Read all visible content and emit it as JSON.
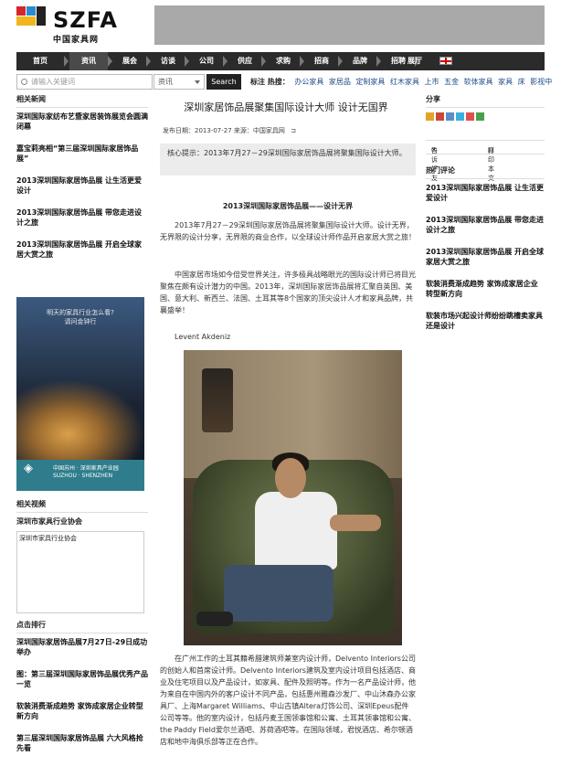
{
  "site": {
    "logo_text": "SZFA",
    "logo_sub": "中国家具网"
  },
  "nav": {
    "items": [
      "首页",
      "资讯",
      "展会",
      "访谈",
      "公司",
      "供应",
      "求购",
      "招商",
      "品牌",
      "招聘",
      "展厅"
    ],
    "active_index": 1
  },
  "search": {
    "placeholder": "请输入关键词",
    "category": "资讯",
    "button": "Search"
  },
  "hot": {
    "label": "标注 热搜：",
    "items": [
      "办公家具",
      "家居品",
      "定制家具",
      "红木家具",
      "上市",
      "五金",
      "软体家具",
      "家具",
      "床",
      "影视中"
    ]
  },
  "left": {
    "related_news_title": "相关新闻",
    "related_news": [
      "深圳国际家纺布艺暨家居装饰展览会圆满闭幕",
      "嘉宝莉亮相“第三届深圳国际家居饰品展”",
      "2013深圳国际家居饰品展 让生活更爱设计",
      "2013深圳国际家居饰品展 带您走进设计之旅",
      "2013深圳国际家居饰品展 开启全球家居大赏之旅"
    ],
    "ad_line1": "明天的家具行业怎么看?",
    "ad_line2": "请问金钟行",
    "ad_brand": "SUZHOU · SHENZHEN",
    "ad_brand_sub": "中国苏州 · 深圳家具产业园",
    "related_video_title": "相关视频",
    "video_link": "深圳市家具行业协会",
    "video_caption": "深圳市家具行业协会",
    "ranking_title": "点击排行",
    "ranking": [
      "深圳国际家居饰品展7月27日-29日成功举办",
      "图：第三届深圳国际家居饰品展优秀产品一览",
      "软装消费渐成趋势 家饰成家居企业转型新方向",
      "第三届深圳国际家居饰品展 六大风格抢先看"
    ]
  },
  "article": {
    "title": "深圳家居饰品展聚集国际设计大师 设计无国界",
    "meta": "发布日期：2013-07-27  来源：中国家具网",
    "tip": "核心提示：2013年7月27－29深圳国际家居饰品展将聚集国际设计大师。",
    "subtitle": "2013深圳国际家居饰品展——设计无界",
    "p1": "2013年7月27－29深圳国际家居饰品展将聚集国际设计大师。设计无界，无界限的设计分享，无界限的商业合作，以全球设计师作品开启家居大赏之旅！",
    "p2": "中国家居市场如今倍受世界关注，许多极具战略眼光的国际设计师已将目光聚焦在颇有设计潜力的中国。2013年，深圳国际家居饰品展将汇聚自英国、美国、意大利、新西兰、法国、土耳其等8个国家的顶尖设计人才和家具品牌，共襄盛举！",
    "name": "Levent Akdeniz",
    "p3": "在广州工作的土耳其籍希腊建筑师兼室内设计师，Delvento Interiors公司的创始人和首席设计师。Delvento Interiors建筑及室内设计项目包括酒店、商业及住宅项目以及产品设计，如家具、配件及照明等。作为一名产品设计师，他为来自在中国内外的客户设计不同产品，包括惠州雅森沙发厂、中山沐森办公家具厂、上海Margaret Williams、中山古镇Altera灯饰公司、深圳Epeus配件公司等等。他的室内设计，包括丹麦王国领事馆和公寓、土耳其领事馆和公寓、the Paddy Field爱尔兰酒吧、苏荷酒吧等。在国际领域，君悦酒店、希尔顿酒店和地中海俱乐部等正在合作。"
  },
  "right": {
    "share_title": "分享",
    "tell_friend": "告诉好友",
    "print": "打印本文",
    "hot_comments_title": "热门评论",
    "hot_comments": [
      "2013深圳国际家居饰品展 让生活更爱设计",
      "2013深圳国际家居饰品展 带您走进设计之旅",
      "2013深圳国际家居饰品展 开启全球家居大赏之旅",
      "软装消费渐成趋势 家饰成家居企业转型新方向",
      "软装市场兴起设计师纷纷跳槽卖家具还是设计"
    ]
  }
}
